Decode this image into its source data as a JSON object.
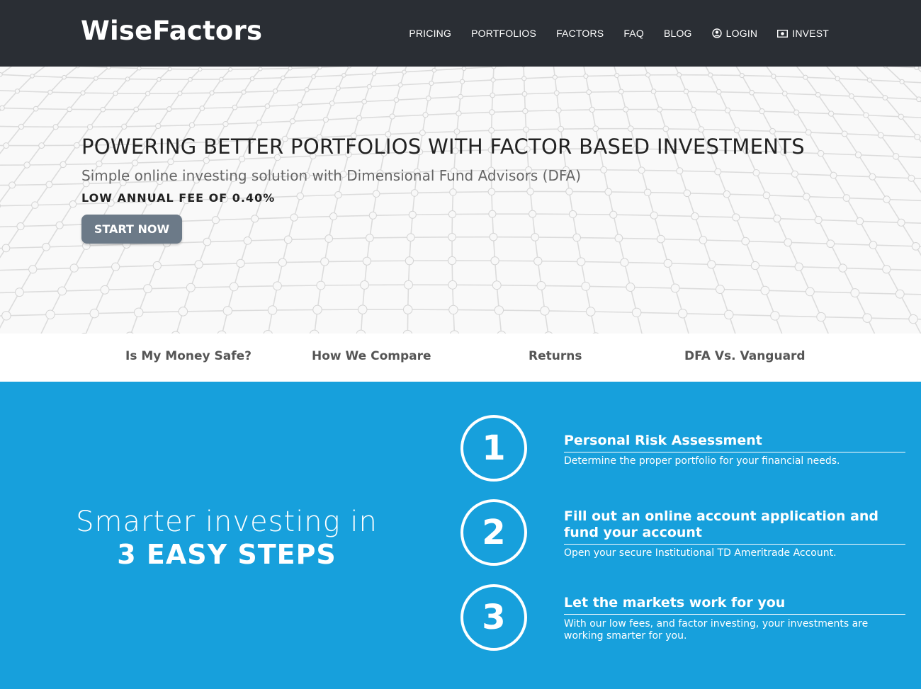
{
  "header": {
    "logo": "WiseFactors",
    "nav": {
      "pricing": "PRICING",
      "portfolios": "PORTFOLIOS",
      "factors": "FACTORS",
      "faq": "FAQ",
      "blog": "BLOG",
      "login": "LOGIN",
      "invest": "INVEST"
    }
  },
  "hero": {
    "title": "POWERING BETTER PORTFOLIOS WITH FACTOR BASED INVESTMENTS",
    "subtitle": "Simple online investing solution with Dimensional Fund Advisors (DFA)",
    "fee": "LOW ANNUAL FEE OF 0.40%",
    "cta": "START NOW"
  },
  "subnav": {
    "safe": "Is My Money Safe?",
    "compare": "How We Compare",
    "returns": "Returns",
    "dfa": "DFA Vs. Vanguard"
  },
  "steps": {
    "tagline_line1": "Smarter investing in",
    "tagline_line2": "3 EASY STEPS",
    "items": [
      {
        "number": "1",
        "title": "Personal Risk Assessment",
        "desc": "Determine the proper portfolio for your financial needs."
      },
      {
        "number": "2",
        "title": "Fill out an online account application and fund your account",
        "desc": "Open your secure Institutional TD Ameritrade Account."
      },
      {
        "number": "3",
        "title": "Let the markets work for you",
        "desc": "With our low fees, and factor investing, your investments are working smarter for you."
      }
    ]
  },
  "colors": {
    "header_bg": "#2a2e34",
    "steps_bg": "#17a0dc",
    "cta_bg": "#6c7a88"
  }
}
